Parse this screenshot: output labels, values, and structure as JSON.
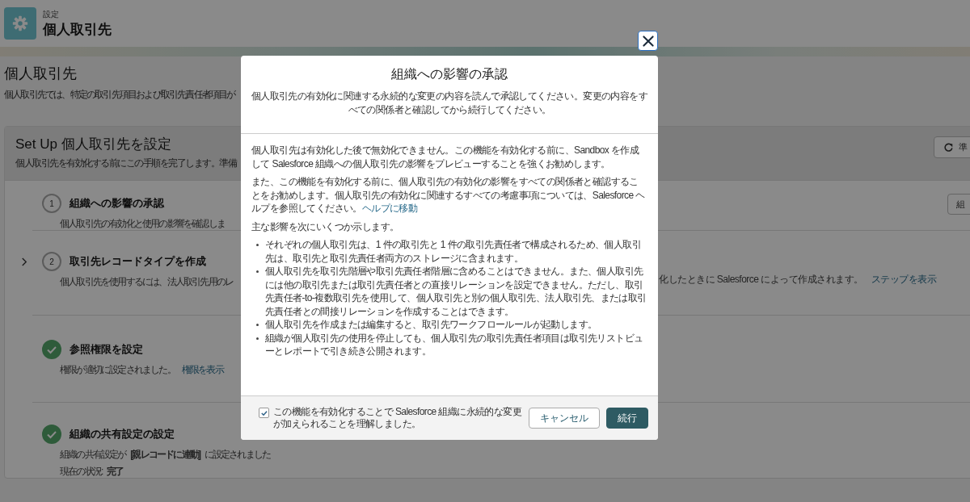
{
  "header": {
    "breadcrumb": "設定",
    "title": "個人取引先"
  },
  "page": {
    "title": "個人取引先",
    "description": "個人取引先では、特定の取引先項目および取引先責任者項目が"
  },
  "setup": {
    "title": "Set Up 個人取引先を設定",
    "description": "個人取引先を有効化する前にこの手順を完了します。準備",
    "refresh_button": "準"
  },
  "steps": [
    {
      "kind": "number",
      "number": "1",
      "expandable": false,
      "title": "組織への影響の承認",
      "description": "個人取引先の有効化と使用の影響を確認しま",
      "button": "組"
    },
    {
      "kind": "number",
      "number": "2",
      "expandable": true,
      "title": "取引先レコードタイプを作成",
      "description": "個人取引先を使用するには、法人取引先用のレ",
      "description_right": "化したときに Salesforce によって作成されます。",
      "link": "ステップを表示"
    },
    {
      "kind": "done",
      "expandable": false,
      "title": "参照権限を設定",
      "description": "権限が適切に設定されました。",
      "link": "権限を表示"
    },
    {
      "kind": "done",
      "expandable": false,
      "title": "組織の共有設定の設定",
      "description": "組織の共有設定が **[親レコードに連動]** に設定されました",
      "status": "現在の状況: **完了**"
    }
  ],
  "modal": {
    "title": "組織への影響の承認",
    "subtitle": "個人取引先の有効化に関連する永続的な変更の内容を読んで承認してください。変更の内容をすべての関係者と確認してから続行してください。",
    "paragraphs": [
      {
        "text": "個人取引先は有効化した後で無効化できません。この機能を有効化する前に、Sandbox を作成して Salesforce 組織への個人取引先の影響をプレビューすることを強くお勧めします。"
      },
      {
        "text": "また、この機能を有効化する前に、個人取引先の有効化の影響をすべての関係者と確認することをお勧めします。個人取引先の有効化に関連するすべての考慮事項については、Salesforce ヘルプを参照してください。",
        "link": "ヘルプに移動"
      },
      {
        "text": "主な影響を次にいくつか示します。"
      }
    ],
    "bullets": [
      "それぞれの個人取引先は、1 件の取引先と 1 件の取引先責任者で構成されるため、個人取引先は、取引先と取引先責任者両方のストレージに含まれます。",
      "個人取引先を取引先階層や取引先責任者階層に含めることはできません。また、個人取引先には他の取引先または取引先責任者との直接リレーションを設定できません。ただし、取引先責任者-to-複数取引先を使用して、個人取引先と別の個人取引先、法人取引先、または取引先責任者との間接リレーションを作成することはできます。",
      "個人取引先を作成または編集すると、取引先ワークフロールールが起動します。",
      "組織が個人取引先の使用を停止しても、個人取引先の取引先責任者項目は取引先リストビューとレポートで引き続き公開されます。"
    ],
    "checkbox": {
      "label": "この機能を有効化することで Salesforce 組織に永続的な変更が加えられることを理解しました。",
      "checked": true
    },
    "buttons": [
      {
        "kind": "neutral",
        "label": "キャンセル"
      },
      {
        "kind": "brand",
        "label": "続行"
      }
    ]
  }
}
